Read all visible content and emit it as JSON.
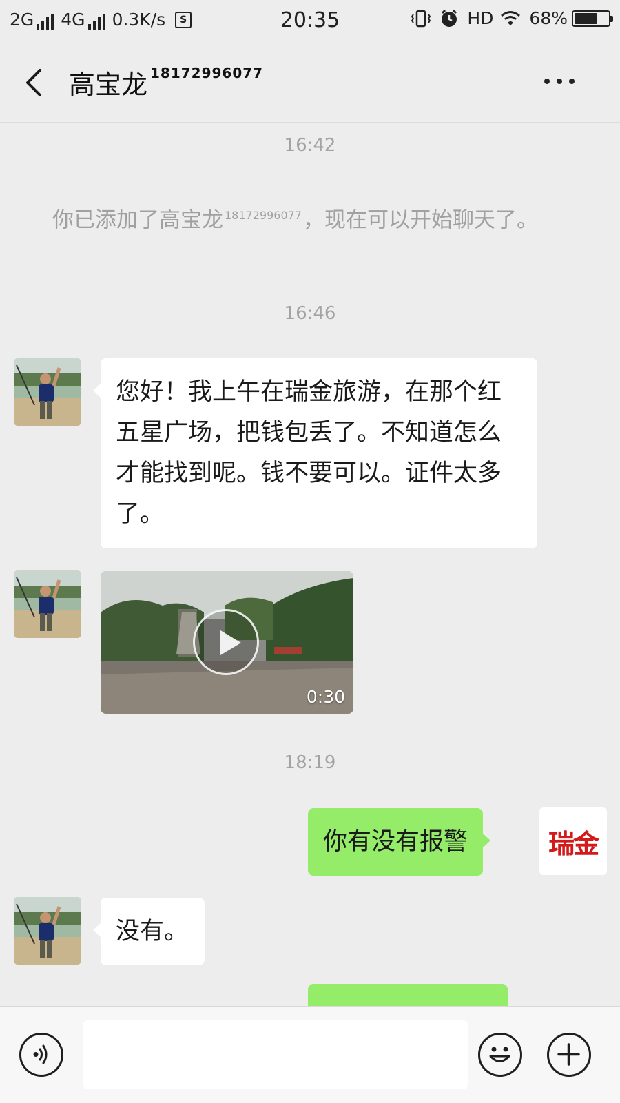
{
  "status_bar": {
    "network1": "2G",
    "network2": "4G",
    "speed": "0.3K/s",
    "s_badge": "S",
    "time": "20:35",
    "hd": "HD",
    "battery": "68%",
    "battery_level": 0.68,
    "icons": [
      "signal-icon",
      "vibrate-icon",
      "alarm-icon",
      "wifi-icon",
      "battery-icon"
    ]
  },
  "header": {
    "contact_name": "高宝龙",
    "contact_number": "18172996077",
    "icons": [
      "back-chevron-icon",
      "more-dots-icon"
    ]
  },
  "chat": {
    "timestamps": [
      "16:42",
      "16:46",
      "18:19"
    ],
    "system_message": {
      "prefix": "你已添加了高宝龙",
      "number": "18172996077",
      "suffix": "，现在可以开始聊天了。"
    },
    "messages": [
      {
        "side": "left",
        "type": "text",
        "text": "您好！我上午在瑞金旅游，在那个红五星广场，把钱包丢了。不知道怎么才能找到呢。钱不要可以。证件太多了。"
      },
      {
        "side": "left",
        "type": "video",
        "duration": "0:30"
      },
      {
        "side": "right",
        "type": "text",
        "text": "你有没有报警"
      },
      {
        "side": "left",
        "type": "text",
        "text": "没有。"
      }
    ],
    "my_avatar_text": "瑞金"
  },
  "input_bar": {
    "icons": [
      "voice-icon",
      "emoji-icon",
      "plus-icon"
    ],
    "input_value": ""
  },
  "colors": {
    "background": "#ededed",
    "my_bubble": "#95ec69",
    "their_bubble": "#ffffff",
    "timestamp": "#a3a3a3",
    "avatar_text": "#d21a1a"
  }
}
